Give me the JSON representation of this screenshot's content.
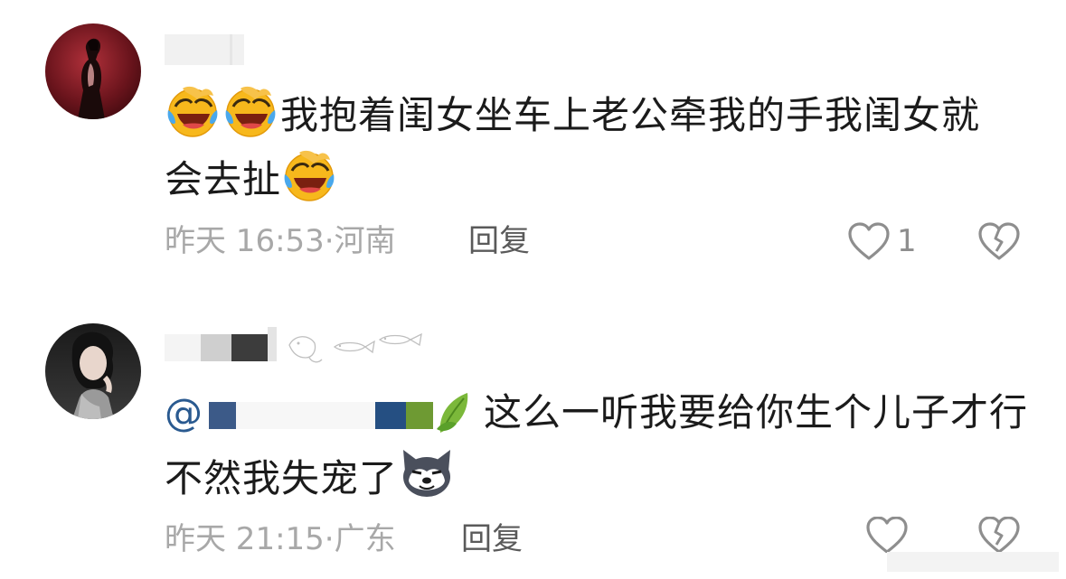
{
  "comments": [
    {
      "text_line1": "我抱着闺女坐车上老公牵我的手我闺女就",
      "text_line2": "会去扯",
      "time": "昨天 16:53",
      "separator": "·",
      "location": "河南",
      "reply_label": "回复",
      "like_count": "1",
      "emoji": "laughing-crying-emoji"
    },
    {
      "mention_at": "@",
      "text_line1": "这么一听我要给你生个儿子才行",
      "text_line2": "不然我失宠了",
      "time": "昨天 21:15",
      "separator": "·",
      "location": "广东",
      "reply_label": "回复",
      "like_count": "",
      "emoji": "husky-emoji"
    }
  ],
  "colors": {
    "meta_gray": "#a8a8a8",
    "reply_gray": "#5a5a5a",
    "mention_blue": "#2a5a90",
    "text_dark": "#1b1b1b"
  }
}
